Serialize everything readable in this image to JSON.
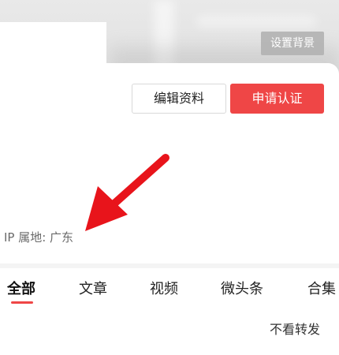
{
  "header": {
    "set_background_label": "设置背景"
  },
  "actions": {
    "edit_profile_label": "编辑资料",
    "apply_verify_label": "申请认证"
  },
  "profile": {
    "ip_location": "IP 属地: 广东"
  },
  "tabs": [
    {
      "label": "全部",
      "active": true
    },
    {
      "label": "文章",
      "active": false
    },
    {
      "label": "视频",
      "active": false
    },
    {
      "label": "微头条",
      "active": false
    },
    {
      "label": "合集",
      "active": false
    }
  ],
  "filter": {
    "no_forward_label": "不看转发"
  },
  "colors": {
    "accent": "#ef4646",
    "annotation_arrow": "#e8141b"
  }
}
